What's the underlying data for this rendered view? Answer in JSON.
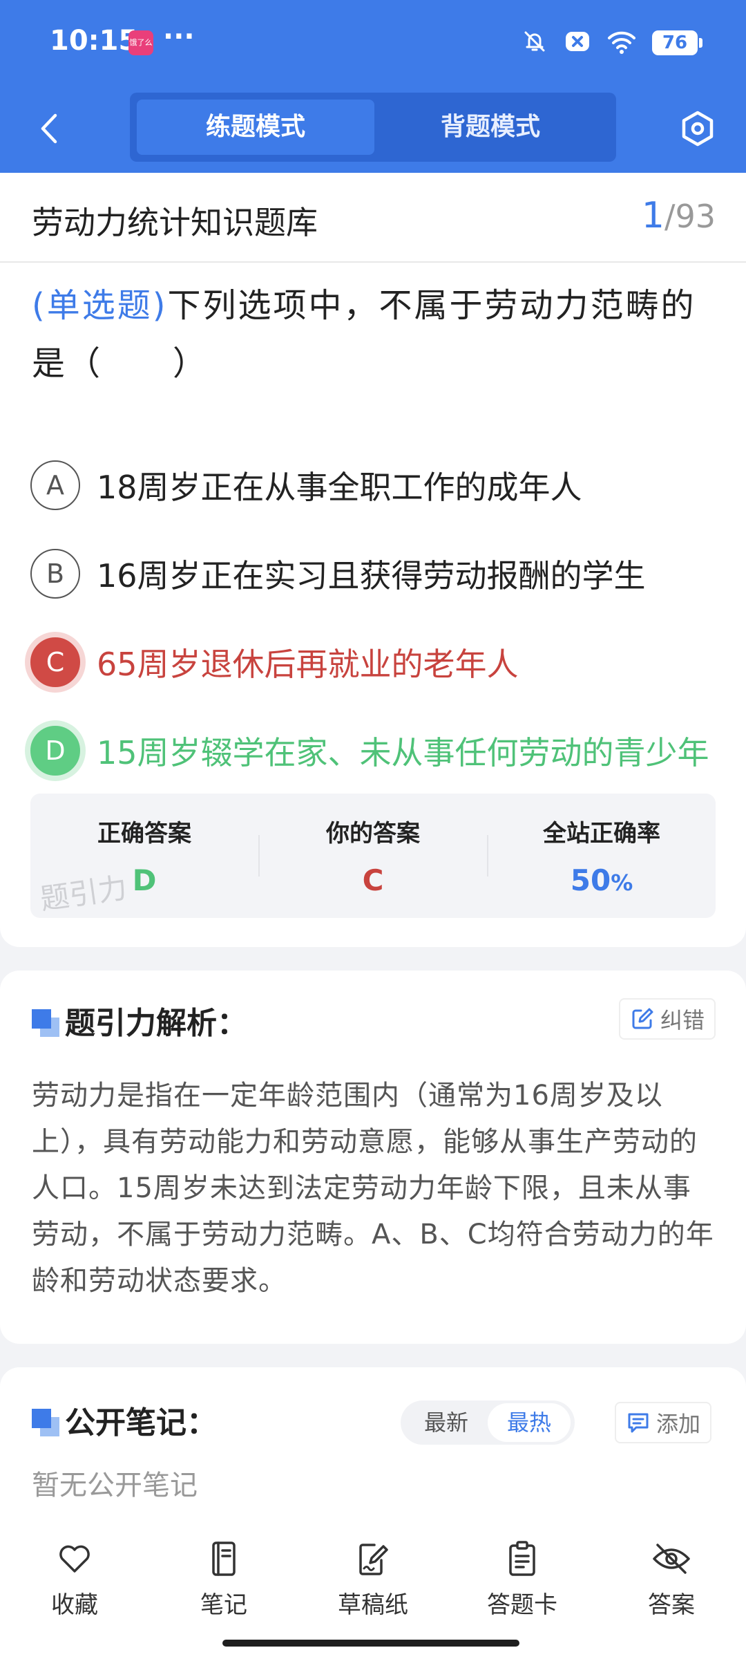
{
  "status_bar": {
    "time": "10:15",
    "notif_app_label": "饿了么",
    "more": "···",
    "battery": "76",
    "icons": [
      "mute-bell-icon",
      "close-badge-icon",
      "wifi-icon",
      "battery-icon"
    ]
  },
  "nav": {
    "back_icon": "chevron-left-icon",
    "tabs": [
      {
        "label": "练题模式",
        "active": true
      },
      {
        "label": "背题模式",
        "active": false
      }
    ],
    "settings_icon": "hexagon-settings-icon"
  },
  "question_header": {
    "bank_title": "劳动力统计知识题库",
    "current": "1",
    "separator": "/",
    "total": "93"
  },
  "question": {
    "type": "(单选题)",
    "text": "下列选项中，不属于劳动力范畴的是（　　）",
    "options": [
      {
        "letter": "A",
        "text": "18周岁正在从事全职工作的成年人",
        "state": "normal"
      },
      {
        "letter": "B",
        "text": "16周岁正在实习且获得劳动报酬的学生",
        "state": "normal"
      },
      {
        "letter": "C",
        "text": "65周岁退休后再就业的老年人",
        "state": "wrong"
      },
      {
        "letter": "D",
        "text": "15周岁辍学在家、未从事任何劳动的青少年",
        "state": "right"
      }
    ]
  },
  "answer_summary": {
    "correct_label": "正确答案",
    "correct_value": "D",
    "yours_label": "你的答案",
    "yours_value": "C",
    "rate_label": "全站正确率",
    "rate_value": "50",
    "rate_unit": "%",
    "watermark": "题引力",
    "colors": {
      "correct": "#4fc278",
      "wrong": "#c8433e",
      "rate": "#3e7be8"
    }
  },
  "analysis": {
    "title": "题引力解析：",
    "report_label": "纠错",
    "text": "劳动力是指在一定年龄范围内（通常为16周岁及以上），具有劳动能力和劳动意愿，能够从事生产劳动的人口。15周岁未达到法定劳动力年龄下限，且未从事劳动，不属于劳动力范畴。A、B、C均符合劳动力的年龄和劳动状态要求。"
  },
  "notes": {
    "title": "公开笔记：",
    "sort_newest": "最新",
    "sort_hottest": "最热",
    "add_label": "添加",
    "empty_text": "暂无公开笔记"
  },
  "bottom_nav": [
    {
      "icon": "heart-icon",
      "label": "收藏"
    },
    {
      "icon": "notebook-icon",
      "label": "笔记"
    },
    {
      "icon": "draft-edit-icon",
      "label": "草稿纸"
    },
    {
      "icon": "clipboard-icon",
      "label": "答题卡"
    },
    {
      "icon": "eye-off-icon",
      "label": "答案"
    }
  ],
  "theme": {
    "primary": "#3e7be8",
    "accent_dark": "#2e66d2"
  }
}
